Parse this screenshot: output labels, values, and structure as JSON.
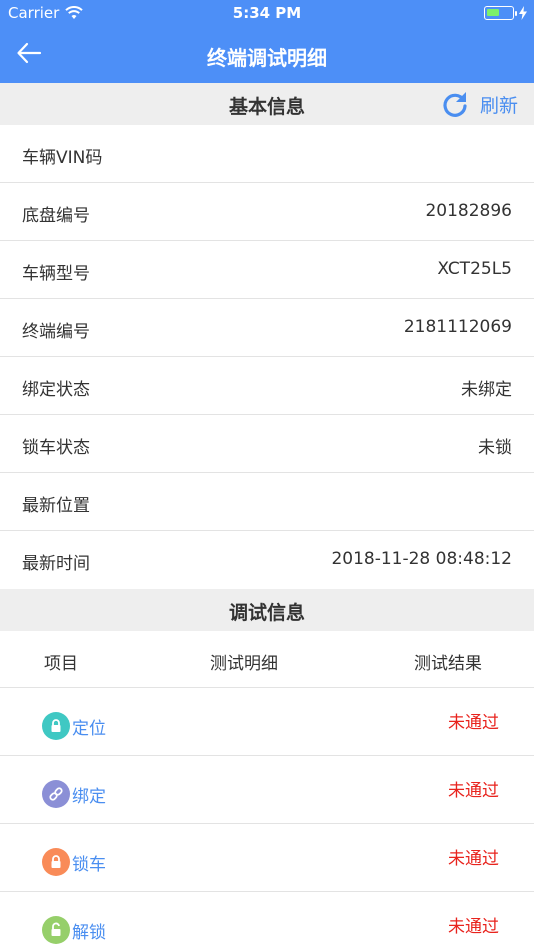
{
  "status_bar": {
    "carrier": "Carrier",
    "time": "5:34 PM"
  },
  "nav": {
    "title": "终端调试明细",
    "back_icon": "back-arrow-icon"
  },
  "basic": {
    "title": "基本信息",
    "refresh_label": "刷新",
    "rows": [
      {
        "label": "车辆VIN码",
        "value": ""
      },
      {
        "label": "底盘编号",
        "value": "20182896"
      },
      {
        "label": "车辆型号",
        "value": "XCT25L5"
      },
      {
        "label": "终端编号",
        "value": "2181112069"
      },
      {
        "label": "绑定状态",
        "value": "未绑定"
      },
      {
        "label": "锁车状态",
        "value": "未锁"
      },
      {
        "label": "最新位置",
        "value": ""
      },
      {
        "label": "最新时间",
        "value": "2018-11-28 08:48:12"
      }
    ]
  },
  "debug": {
    "title": "调试信息",
    "columns": [
      "项目",
      "测试明细",
      "测试结果"
    ],
    "items": [
      {
        "label": "定位",
        "icon": "lock-icon",
        "color": "#3fc8c3",
        "result": "未通过"
      },
      {
        "label": "绑定",
        "icon": "link-icon",
        "color": "#8b8fd6",
        "result": "未通过"
      },
      {
        "label": "锁车",
        "icon": "lock-icon",
        "color": "#f98b58",
        "result": "未通过"
      },
      {
        "label": "解锁",
        "icon": "unlock-icon",
        "color": "#96cf6a",
        "result": "未通过"
      }
    ]
  },
  "colors": {
    "accent": "#4d8ff7",
    "fail": "#e8231d",
    "link": "#4a8ef0"
  }
}
